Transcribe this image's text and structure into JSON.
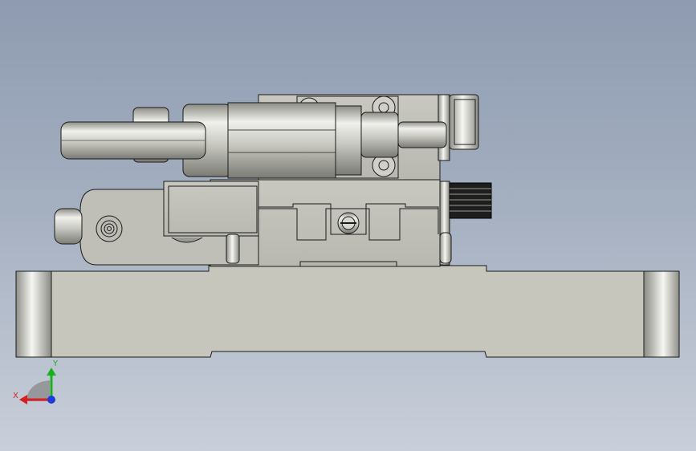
{
  "viewport": {
    "background_top": "#8e9bb0",
    "background_bottom": "#c9cfda"
  },
  "model": {
    "base_color": "#c4c4bb",
    "part_color": "#bdbdb5",
    "edge_color": "#1a1a1a",
    "highlight_color": "#f4f4f0",
    "shadow_color": "#8a8a84"
  },
  "triad": {
    "x_label": "X",
    "y_label": "Y",
    "x_color": "#d42020",
    "y_color": "#18b020",
    "z_color": "#1f3ad8"
  }
}
